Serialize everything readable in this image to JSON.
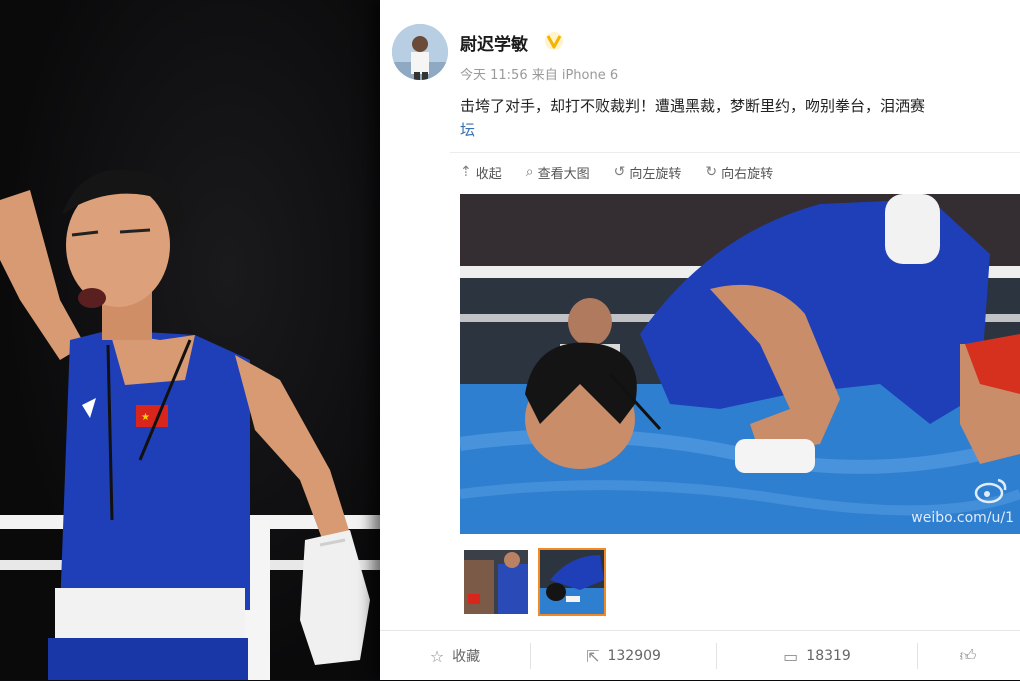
{
  "post": {
    "username": "尉迟学敏",
    "meta": "今天 11:56 来自 iPhone 6",
    "text_line1": "击垮了对手，却打不败裁判！遭遇黑裁，梦断里约，吻别拳台，泪洒赛",
    "text_line2": "坛"
  },
  "toolbar": {
    "collapse": "收起",
    "view_large": "查看大图",
    "rotate_left": "向左旋转",
    "rotate_right": "向右旋转"
  },
  "image": {
    "watermark": "weibo.com/u/1"
  },
  "actions": {
    "favorite_label": "收藏",
    "repost_count": "132909",
    "comment_count": "18319"
  },
  "icons": {
    "verified": "verified-v-icon",
    "collapse": "arrow-up-icon",
    "view_large": "search-icon",
    "rotate_left": "rotate-left-icon",
    "rotate_right": "rotate-right-icon",
    "favorite": "star-icon",
    "repost": "share-icon",
    "comment": "comment-icon",
    "like": "thumb-up-icon"
  },
  "colors": {
    "verified_badge": "#f5b400",
    "link_blue": "#3a6fb0",
    "active_thumb_border": "#f08a24",
    "jersey_blue": "#1f3fb8"
  }
}
